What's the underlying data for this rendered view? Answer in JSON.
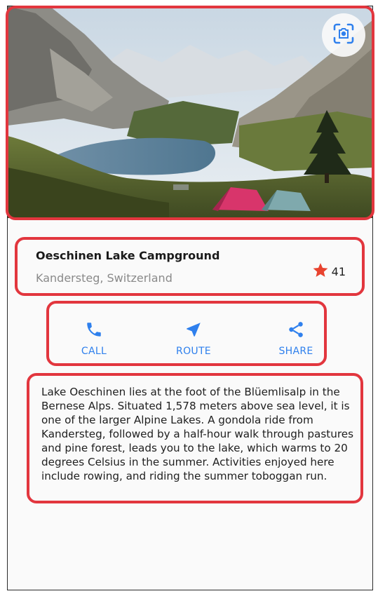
{
  "place": {
    "name": "Oeschinen Lake Campground",
    "location": "Kandersteg, Switzerland",
    "rating_count": "41"
  },
  "actions": {
    "call_label": "CALL",
    "route_label": "ROUTE",
    "share_label": "SHARE"
  },
  "description": "Lake Oeschinen lies at the foot of the Blüemlisalp in the Bernese Alps. Situated 1,578 meters above sea level, it is one of the larger Alpine Lakes. A gondola ride from Kandersteg, followed by a half-hour walk through pastures and pine forest, leads you to the lake, which warms to 20 degrees Celsius in the summer. Activities enjoyed here include rowing, and riding the summer toboggan run.",
  "icons": {
    "scan": "scan-icon",
    "star": "star-icon",
    "call": "phone-icon",
    "route": "navigation-arrow-icon",
    "share": "share-icon"
  },
  "colors": {
    "accent": "#2f80ed",
    "star": "#e8432f",
    "highlight": "#e2363e"
  }
}
